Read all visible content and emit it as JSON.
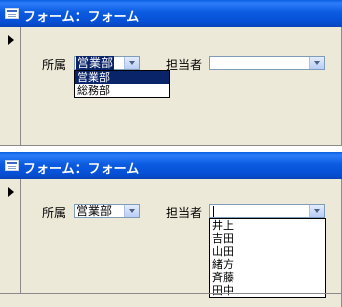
{
  "windows": [
    {
      "title": "フォーム：フォーム",
      "fields": {
        "dept_label": "所属",
        "dept_value": "営業部",
        "person_label": "担当者",
        "person_value": ""
      },
      "dropdown": {
        "for": "所属",
        "options": [
          "営業部",
          "総務部"
        ],
        "highlighted": "営業部"
      }
    },
    {
      "title": "フォーム：フォーム",
      "fields": {
        "dept_label": "所属",
        "dept_value": "営業部",
        "person_label": "担当者",
        "person_value": ""
      },
      "dropdown": {
        "for": "担当者",
        "options": [
          "井上",
          "吉田",
          "山田",
          "緒方",
          "斉藤",
          "田中"
        ],
        "highlighted": ""
      }
    }
  ],
  "colors": {
    "titlebar": "#0550d6",
    "form_background": "#ece9d8",
    "selection": "#0a246a"
  },
  "icons": {
    "title_icon": "form-window-icon",
    "record_selector": "current-record-arrow-icon",
    "combo_button": "chevron-down-icon"
  }
}
